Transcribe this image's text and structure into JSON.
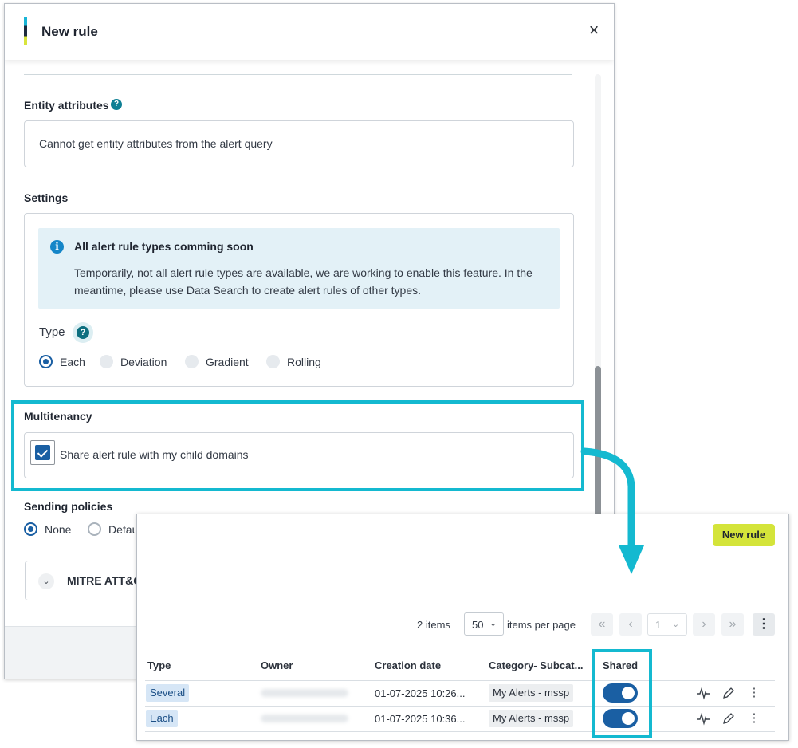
{
  "modal": {
    "title": "New rule",
    "close_icon": "×",
    "entity_attributes": {
      "label": "Entity attributes",
      "help": "?",
      "value": "Cannot get entity attributes from the alert query"
    },
    "settings": {
      "label": "Settings",
      "banner": {
        "icon": "i",
        "title": "All alert rule types comming soon",
        "body": "Temporarily, not all alert rule types are available, we are working to enable this feature. In the meantime, please use Data Search to create alert rules of other types."
      },
      "type_label": "Type",
      "type_help": "?",
      "type_options": [
        "Each",
        "Deviation",
        "Gradient",
        "Rolling"
      ],
      "type_selected": "Each"
    },
    "multitenancy": {
      "label": "Multitenancy",
      "checkbox_label": "Share alert rule with my child domains",
      "checked": true
    },
    "sending_policies": {
      "label": "Sending policies",
      "options": [
        "None",
        "Defau"
      ],
      "selected": "None"
    },
    "mitre": {
      "label": "MITRE ATT&C",
      "chevron": "⌄"
    }
  },
  "panel": {
    "new_rule_label": "New rule",
    "pagination": {
      "items_count": "2 items",
      "per_page_value": "50",
      "per_page_label": "items per page",
      "first": "«",
      "prev": "‹",
      "page_value": "1",
      "next": "›",
      "last": "»",
      "menu": "⋮",
      "chevron": "⌄"
    },
    "columns": [
      "Type",
      "Owner",
      "Creation date",
      "Category- Subcat...",
      "Shared"
    ],
    "rows": [
      {
        "type": "Several",
        "date": "01-07-2025 10:26...",
        "category": "My Alerts - mssp",
        "shared": true
      },
      {
        "type": "Each",
        "date": "01-07-2025 10:36...",
        "category": "My Alerts - mssp",
        "shared": true
      }
    ],
    "row_icons": {
      "activity": "activity-icon",
      "edit": "pencil-icon",
      "more": "⋮"
    }
  },
  "colors": {
    "highlight": "#14b9d0",
    "primary": "#1a5fa3",
    "new_rule_button": "#d4e43a"
  }
}
